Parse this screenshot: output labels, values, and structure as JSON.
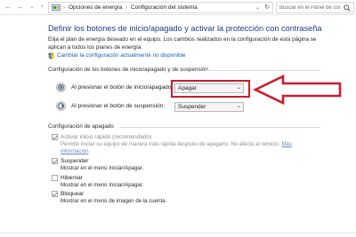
{
  "nav": {
    "back_icon": "arrow-left-icon",
    "forward_icon": "arrow-right-icon",
    "up_icon": "arrow-up-icon",
    "crumbs": [
      "Opciones de energía",
      "Configuración del sistema"
    ],
    "search_placeholder": "Buscar en el Panel de control"
  },
  "page": {
    "title": "Definir los botones de inicio/apagado y activar la protección con contraseña",
    "description": "Elija el plan de energía deseado en el equipo. Los cambios realizados en la configuración de esta página se aplican a todos los planes de energía.",
    "change_link": "Cambiar la configuración actualmente no disponible"
  },
  "buttons_section": {
    "heading": "Configuración de los botones de inicio/apagado y de suspensión",
    "rows": [
      {
        "label": "Al presionar el botón de inicio/apagado:",
        "value": "Apagar"
      },
      {
        "label": "Al presionar el botón de suspensión:",
        "value": "Suspender"
      }
    ]
  },
  "shutdown_section": {
    "heading": "Configuración de apagado",
    "items": [
      {
        "label": "Activar inicio rápido (recomendado)",
        "checked": true,
        "disabled": true,
        "desc1": "Permite iniciar su equipo de manera más rápida después de apagarlo. No afecta al reinicio.",
        "link": "Más",
        "desc2": "información"
      },
      {
        "label": "Suspender",
        "checked": true,
        "disabled": false,
        "desc1": "Mostrar en el menú Iniciar/Apagar."
      },
      {
        "label": "Hibernar",
        "checked": false,
        "disabled": false,
        "desc1": "Mostrar en el menú Iniciar/Apagar."
      },
      {
        "label": "Bloquear",
        "checked": true,
        "disabled": false,
        "desc1": "Mostrar en el menú de imagen de la cuenta."
      }
    ]
  },
  "colors": {
    "title": "#1a3d8a",
    "link": "#1a5fb4",
    "annotation_red": "#c81e2e"
  }
}
